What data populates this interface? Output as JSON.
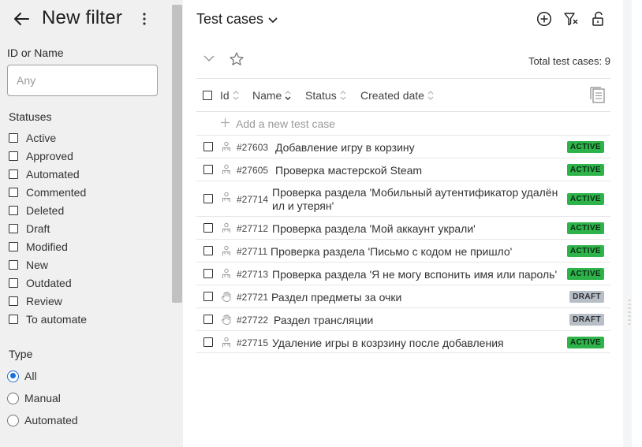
{
  "filter_panel": {
    "title": "New filter",
    "id_label": "ID or Name",
    "id_placeholder": "Any",
    "id_value": "",
    "statuses_label": "Statuses",
    "statuses": [
      "Active",
      "Approved",
      "Automated",
      "Commented",
      "Deleted",
      "Draft",
      "Modified",
      "New",
      "Outdated",
      "Review",
      "To automate"
    ],
    "type_label": "Type",
    "types": [
      {
        "label": "All",
        "selected": true
      },
      {
        "label": "Manual",
        "selected": false
      },
      {
        "label": "Automated",
        "selected": false
      }
    ]
  },
  "main": {
    "title": "Test cases",
    "total_label": "Total test cases: 9",
    "columns": {
      "id": "Id",
      "name": "Name",
      "status": "Status",
      "created": "Created date"
    },
    "add_label": "Add a new test case",
    "rows": [
      {
        "icon": "automated-icon",
        "id": "#27603",
        "name": "Добавление игру в корзину",
        "status": "ACTIVE"
      },
      {
        "icon": "automated-icon",
        "id": "#27605",
        "name": "Проверка мастерской Steam",
        "status": "ACTIVE"
      },
      {
        "icon": "automated-icon",
        "id": "#27714",
        "name": "Проверка раздела 'Мобильный аутентификатор удалён ил и утерян'",
        "status": "ACTIVE"
      },
      {
        "icon": "automated-icon",
        "id": "#27712",
        "name": "Проверка раздела 'Мой аккаунт украли'",
        "status": "ACTIVE"
      },
      {
        "icon": "automated-icon",
        "id": "#27711",
        "name": "Проверка раздела 'Письмо с кодом не пришло'",
        "status": "ACTIVE"
      },
      {
        "icon": "automated-icon",
        "id": "#27713",
        "name": "Проверка раздела 'Я не могу вспонить имя или пароль'",
        "status": "ACTIVE"
      },
      {
        "icon": "manual-icon",
        "id": "#27721",
        "name": "Раздел предметы за очки",
        "status": "DRAFT"
      },
      {
        "icon": "manual-icon",
        "id": "#27722",
        "name": "Раздел трансляции",
        "status": "DRAFT"
      },
      {
        "icon": "automated-icon",
        "id": "#27715",
        "name": "Удаление игры в козрзину после добавления",
        "status": "ACTIVE"
      }
    ]
  },
  "colors": {
    "active": "#2eb34a",
    "draft": "#b8bec6",
    "accent": "#1a6fd6",
    "panel": "#f0f0f1"
  }
}
